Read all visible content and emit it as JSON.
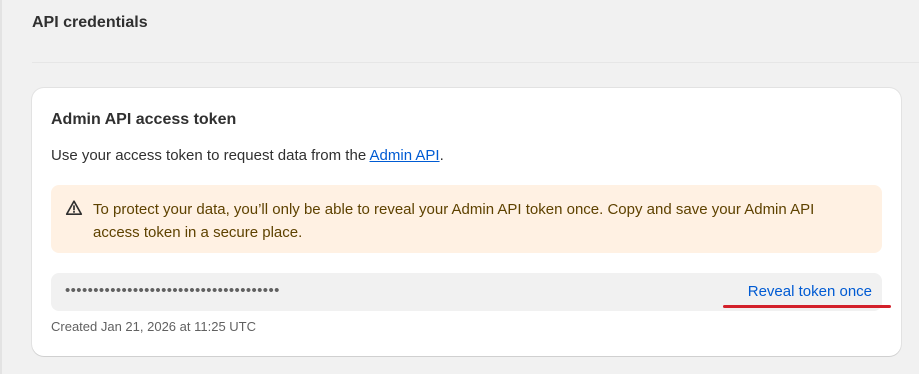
{
  "section": {
    "title": "API credentials"
  },
  "card": {
    "title": "Admin API access token",
    "desc_prefix": "Use your access token to request data from the ",
    "desc_link": "Admin API",
    "desc_suffix": ".",
    "banner": {
      "icon": "warning-triangle-icon",
      "text": "To protect your data, you’ll only be able to reveal your Admin API token once. Copy and save your Admin API access token in a secure place."
    },
    "token": {
      "masked_value": "••••••••••••••••••••••••••••••••••••••",
      "reveal_label": "Reveal token once"
    },
    "created": "Created Jan 21, 2026 at 11:25 UTC"
  },
  "colors": {
    "link": "#005bd3",
    "banner_bg": "#fff1e3",
    "highlight_underline": "#d3202a"
  }
}
